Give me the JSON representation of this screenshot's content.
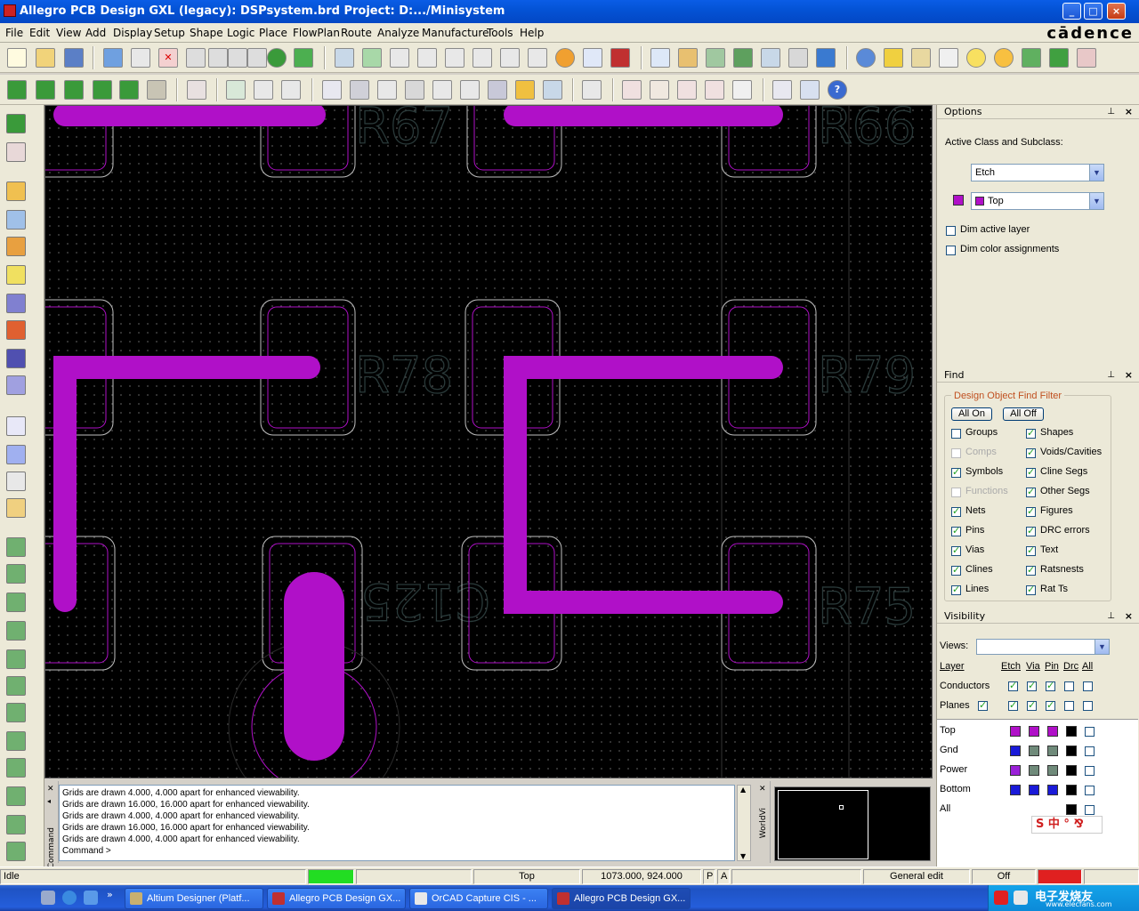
{
  "window": {
    "title": "Allegro PCB Design GXL (legacy): DSPsystem.brd  Project: D:.../Minisystem",
    "min": "_",
    "max": "□",
    "close": "×"
  },
  "menu": [
    "File",
    "Edit",
    "View",
    "Add",
    "Display",
    "Setup",
    "Shape",
    "Logic",
    "Place",
    "FlowPlan",
    "Route",
    "Analyze",
    "Manufacture",
    "Tools",
    "Help"
  ],
  "brand": "cādence",
  "canvas": {
    "refdes": [
      "R67",
      "R66",
      "R78",
      "R79",
      "C125",
      "R75"
    ],
    "colors": {
      "trace": "#b010c8",
      "pad_outer": "#bfbfbf",
      "pad_inner": "#b010c8",
      "text": "#2a3a3a"
    }
  },
  "command": {
    "tab_label": "Command",
    "lines": [
      "Grids are drawn 4.000, 4.000 apart for enhanced viewability.",
      "Grids are drawn 16.000, 16.000 apart for enhanced viewability.",
      "Grids are drawn 4.000, 4.000 apart for enhanced viewability.",
      "Grids are drawn 16.000, 16.000 apart for enhanced viewability.",
      "Grids are drawn 4.000, 4.000 apart for enhanced viewability.",
      "Command >"
    ]
  },
  "worldview": {
    "tab_label": "WorldVi"
  },
  "options": {
    "title": "Options",
    "active_label": "Active Class and Subclass:",
    "class_value": "Etch",
    "subclass_value": "Top",
    "subclass_color": "#b010c8",
    "dim_active": "Dim active layer",
    "dim_color": "Dim color assignments"
  },
  "find": {
    "title": "Find",
    "group_title": "Design Object Find Filter",
    "all_on": "All On",
    "all_off": "All Off",
    "left": [
      {
        "label": "Groups",
        "checked": false,
        "disabled": false
      },
      {
        "label": "Comps",
        "checked": false,
        "disabled": true
      },
      {
        "label": "Symbols",
        "checked": true,
        "disabled": false
      },
      {
        "label": "Functions",
        "checked": false,
        "disabled": true
      },
      {
        "label": "Nets",
        "checked": true,
        "disabled": false
      },
      {
        "label": "Pins",
        "checked": true,
        "disabled": false
      },
      {
        "label": "Vias",
        "checked": true,
        "disabled": false
      },
      {
        "label": "Clines",
        "checked": true,
        "disabled": false
      },
      {
        "label": "Lines",
        "checked": true,
        "disabled": false
      }
    ],
    "right": [
      {
        "label": "Shapes",
        "checked": true
      },
      {
        "label": "Voids/Cavities",
        "checked": true
      },
      {
        "label": "Cline Segs",
        "checked": true
      },
      {
        "label": "Other Segs",
        "checked": true
      },
      {
        "label": "Figures",
        "checked": true
      },
      {
        "label": "DRC errors",
        "checked": true
      },
      {
        "label": "Text",
        "checked": true
      },
      {
        "label": "Ratsnests",
        "checked": true
      },
      {
        "label": "Rat Ts",
        "checked": true
      }
    ]
  },
  "visibility": {
    "title": "Visibility",
    "views_label": "Views:",
    "headers": [
      "Layer",
      "Etch",
      "Via",
      "Pin",
      "Drc",
      "All"
    ],
    "conductors": "Conductors",
    "planes": "Planes",
    "layers": [
      {
        "name": "Top",
        "colors": [
          "#b010c8",
          "#b010c8",
          "#b010c8",
          "#000000"
        ]
      },
      {
        "name": "Gnd",
        "colors": [
          "#1a1ad8",
          "#6f8a7a",
          "#6f8a7a",
          "#000000"
        ]
      },
      {
        "name": "Power",
        "colors": [
          "#9a20d8",
          "#6f8a7a",
          "#6f8a7a",
          "#000000"
        ]
      },
      {
        "name": "Bottom",
        "colors": [
          "#1a1ad8",
          "#1a1ad8",
          "#1a1ad8",
          "#000000"
        ]
      },
      {
        "name": "All",
        "colors": [
          "",
          "",
          "",
          "#000000"
        ]
      }
    ]
  },
  "status": {
    "state": "Idle",
    "layer": "Top",
    "coords": "1073.000, 924.000",
    "p": "P",
    "a": "A",
    "mode": "General edit",
    "off": "Off"
  },
  "taskbar": {
    "items": [
      {
        "label": "Altium Designer (Platf..."
      },
      {
        "label": "Allegro PCB Design GX..."
      },
      {
        "label": "OrCAD Capture CIS - ..."
      },
      {
        "label": "Allegro PCB Design GX..."
      }
    ],
    "tray_text": "电子发烧友",
    "tray_url": "www.elecfans.com"
  }
}
